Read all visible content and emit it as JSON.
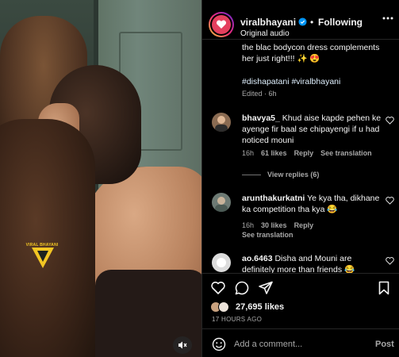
{
  "post": {
    "username": "viralbhayani",
    "follow_state": "Following",
    "separator": "•",
    "audio": "Original audio",
    "watermark": "VIRAL BHAYANI"
  },
  "caption": {
    "text": "the blac bodycon dress complements her just right!!! ✨ 😍",
    "hashtags": "#dishapatani #viralbhayani",
    "edited": "Edited · 6h"
  },
  "comments": [
    {
      "username": "bhavya5_",
      "text": "Khud aise kapde pehen ke ayenge fir baal se chipayengi if u had noticed mouni",
      "time": "16h",
      "likes": "61 likes",
      "reply": "Reply",
      "translate": "See translation",
      "view_replies": "View replies (6)"
    },
    {
      "username": "arunthakurkatni",
      "text": "Ye kya tha, dikhane ka competition tha kya 😂",
      "time": "16h",
      "likes": "30 likes",
      "reply": "Reply",
      "translate": "See translation"
    },
    {
      "username": "ao.6463",
      "text": "Disha and Mouni are definitely more than friends 😂"
    }
  ],
  "actions": {
    "likes": "27,695 likes",
    "date": "17 HOURS AGO"
  },
  "composer": {
    "placeholder": "Add a comment...",
    "post_label": "Post"
  },
  "icons": [
    "verified-icon",
    "more-icon",
    "heart-icon",
    "comment-icon",
    "share-icon",
    "emoji-icon",
    "mute-icon"
  ],
  "colors": {
    "background": "#000000",
    "text": "#f5f5f5",
    "muted": "#a8a8a8",
    "verified": "#0095f6",
    "border": "#262626"
  }
}
